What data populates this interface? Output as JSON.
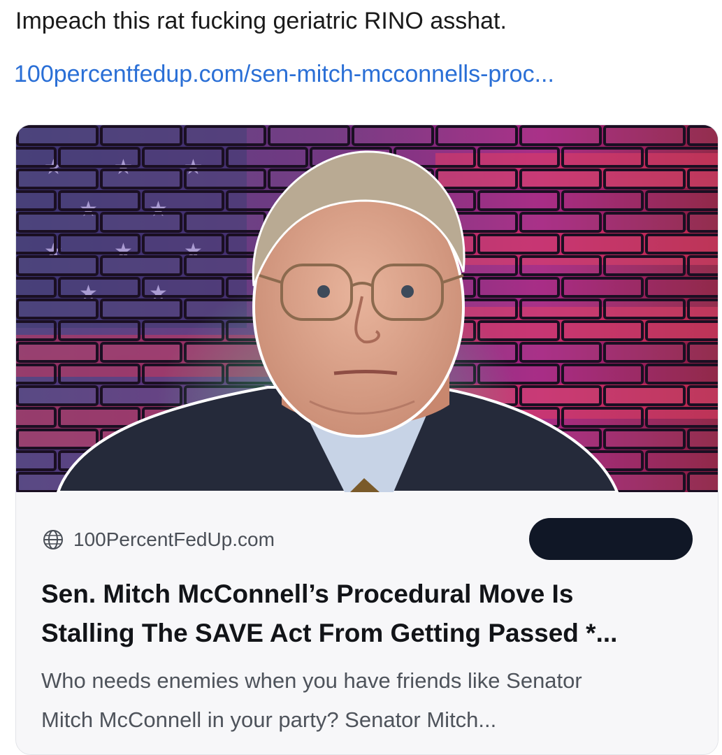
{
  "post": {
    "text": "Impeach this rat fucking geriatric RINO asshat.",
    "link_text": "100percentfedup.com/sen-mitch-mcconnells-proc..."
  },
  "link_card": {
    "domain": "100PercentFedUp.com",
    "title_line1": "Sen. Mitch McConnell’s Procedural Move Is",
    "title_line2": "Stalling The SAVE Act From Getting Passed *...",
    "description_line1": "Who needs enemies when you have friends like Senator",
    "description_line2": "Mitch McConnell in your party? Senator Mitch..."
  },
  "icons": {
    "domain": "globe-icon"
  },
  "colors": {
    "link": "#2a6fd6",
    "card_background": "#f7f7f9",
    "redaction": "#101726"
  }
}
